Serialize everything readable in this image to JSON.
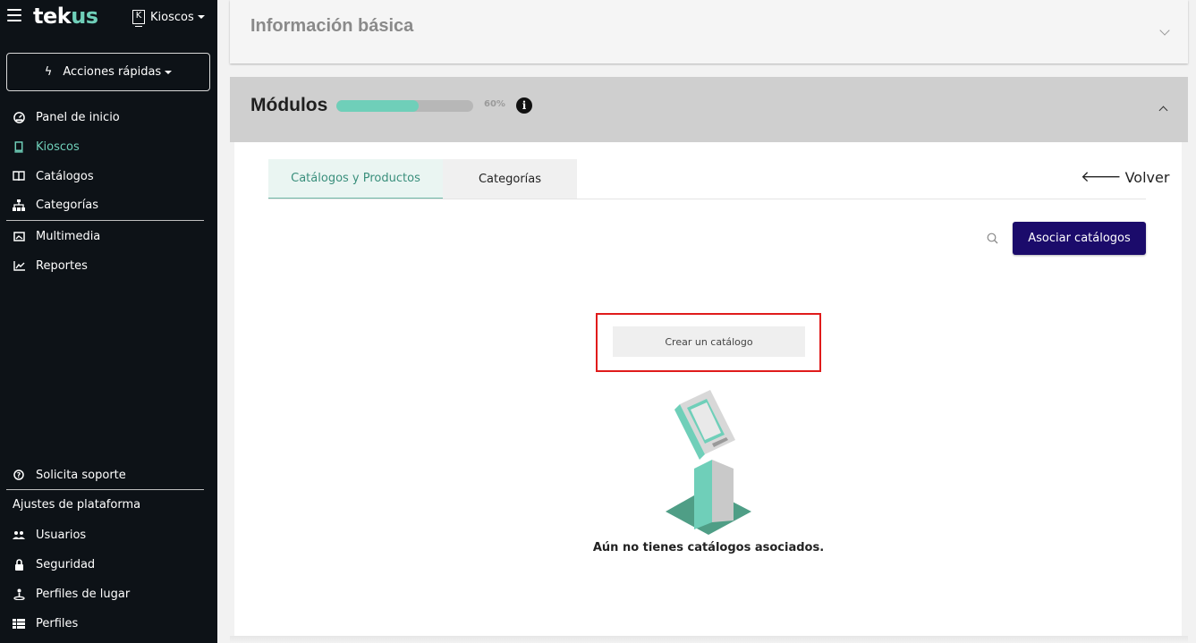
{
  "sidebar": {
    "logo_main": "tek",
    "logo_accent": "us",
    "product_switch_label": "Kioscos",
    "product_icon_letter": "K",
    "quick_actions_label": "Acciones rápidas",
    "nav": [
      {
        "label": "Panel de inicio",
        "icon": "dashboard-icon"
      },
      {
        "label": "Kioscos",
        "icon": "kiosk-icon",
        "active": true
      },
      {
        "label": "Catálogos",
        "icon": "book-icon"
      },
      {
        "label": "Categorías",
        "icon": "sitemap-icon"
      },
      {
        "label": "Multimedia",
        "icon": "image-icon"
      },
      {
        "label": "Reportes",
        "icon": "chart-line-icon"
      }
    ],
    "support_label": "Solicita soporte",
    "settings_heading": "Ajustes de plataforma",
    "settings": [
      {
        "label": "Usuarios",
        "icon": "users-icon"
      },
      {
        "label": "Seguridad",
        "icon": "lock-icon"
      },
      {
        "label": "Perfiles de lugar",
        "icon": "place-profile-icon"
      },
      {
        "label": "Perfiles",
        "icon": "profiles-icon"
      }
    ]
  },
  "basic_info": {
    "title": "Información básica"
  },
  "modules": {
    "title": "Módulos",
    "progress": 60,
    "progress_label": "60%"
  },
  "tabs": [
    {
      "label": "Catálogos y Productos",
      "active": true
    },
    {
      "label": "Categorías",
      "active": false
    }
  ],
  "back_label": "Volver",
  "associate_button_label": "Asociar catálogos",
  "create_button_label": "Crear un catálogo",
  "empty_state_text": "Aún no tienes catálogos asociados.",
  "colors": {
    "sidebar_bg": "#0d1217",
    "accent": "#6fcfb9",
    "primary_button": "#1b0b6b",
    "highlight_border": "#e01b1b"
  }
}
